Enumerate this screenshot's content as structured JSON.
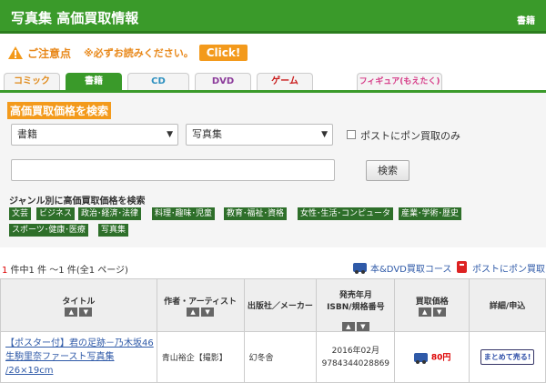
{
  "header": {
    "title": "写真集 高価買取情報",
    "category": "書籍"
  },
  "notice": {
    "caution": "ご注意点",
    "must_read": "※必ずお読みください。",
    "click": "Click!"
  },
  "tabs": [
    {
      "label": "コミック",
      "color": "#e08a1a"
    },
    {
      "label": "書籍",
      "color": "#ffffff"
    },
    {
      "label": "CD",
      "color": "#2b8fbf"
    },
    {
      "label": "DVD",
      "color": "#8b3a9a"
    },
    {
      "label": "ゲーム",
      "color": "#c91919"
    },
    {
      "label": "フィギュア(もえたく)",
      "color": "#d63c88"
    }
  ],
  "search": {
    "heading": "高価買取価格を検索",
    "select1": "書籍",
    "select2": "写真集",
    "post_checkbox": "ポストにポン買取のみ",
    "search_button": "検索",
    "genre_heading": "ジャンル別に高価買取価格を検索",
    "genres": [
      "文芸",
      "ビジネス",
      "政治･経済･法律",
      "料理･趣味･児童",
      "教育･福祉･資格",
      "女性･生活･コンピュータ",
      "産業･学術･歴史",
      "スポーツ･健康･医療",
      "写真集"
    ]
  },
  "results": {
    "count_prefix": "1",
    "count_text": " 件中1 件 ～1 件(全1 ページ)",
    "course_book_dvd": "本&DVD買取コース",
    "course_post": "ポストにポン買取"
  },
  "table": {
    "headers": [
      "タイトル",
      "作者・アーティスト",
      "出版社／メーカー",
      "発売年月\nISBN/規格番号",
      "買取価格",
      "詳細/申込"
    ],
    "rows": [
      {
        "title": "【ポスター付】君の足跡－乃木坂46生駒里奈ファースト写真集 /26×19cm",
        "author": "青山裕企【撮影】",
        "publisher": "幻冬舎",
        "date": "2016年02月",
        "isbn": "9784344028869",
        "price": "80円",
        "action": "まとめて売る!"
      }
    ]
  }
}
